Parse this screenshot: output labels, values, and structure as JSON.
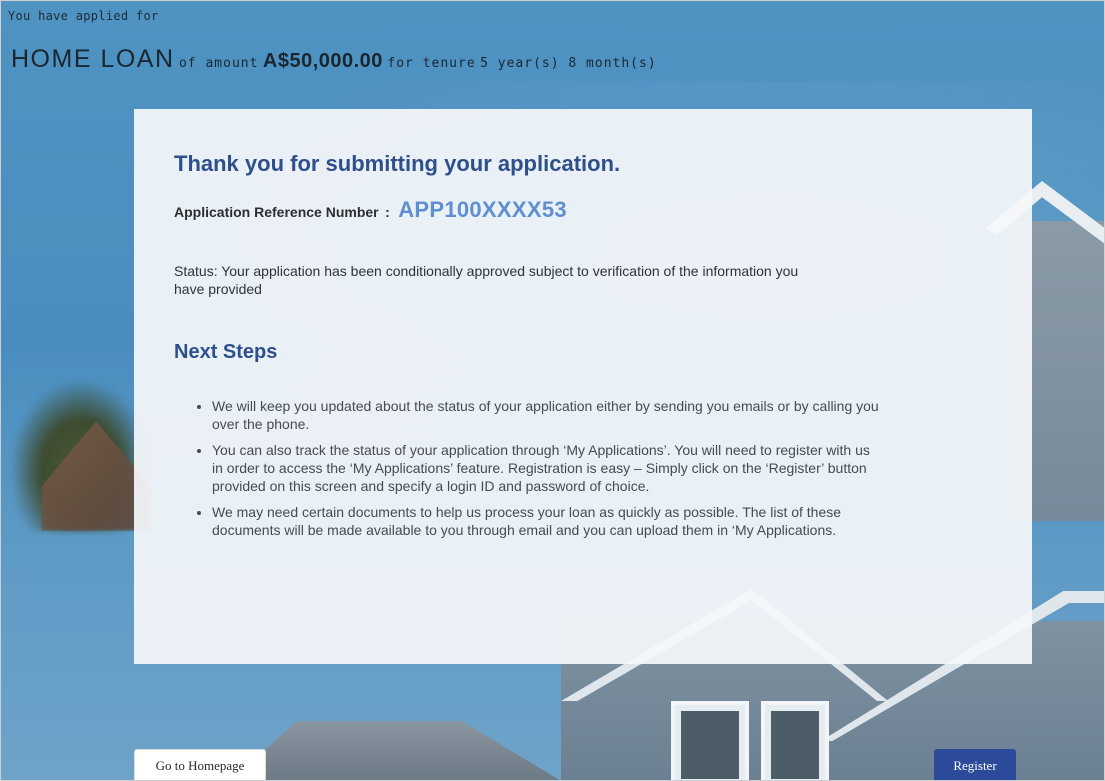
{
  "header": {
    "applied_label": "You have applied for",
    "loan_type": "HOME LOAN",
    "of_amount_label": "of amount",
    "amount": "A$50,000.00",
    "tenure_label": "for tenure",
    "tenure": "5 year(s) 8 month(s)"
  },
  "confirmation": {
    "title": "Thank you for submitting your application.",
    "reference_label": "Application Reference Number",
    "reference_separator": ":",
    "reference_number": "APP100XXXX53",
    "status": "Status: Your application has been conditionally approved subject to verification of the information you have provided",
    "next_steps_title": "Next Steps",
    "next_steps": [
      "We will keep you updated about the status of your application either by sending you emails or by calling you over the phone.",
      "You can also track the status of your application through ‘My Applications’. You will need to register with us in order to access the ‘My Applications’ feature. Registration is easy – Simply click on the ‘Register’ button provided on this screen and specify a login ID and password of choice.",
      "We may need certain documents to help us process your loan as quickly as possible. The list of these documents will be made available to you through email and you can upload them in ‘My Applications."
    ]
  },
  "actions": {
    "home_label": "Go to Homepage",
    "register_label": "Register"
  },
  "colors": {
    "accent": "#2f4f8b",
    "reference": "#5f8fd1",
    "register_button": "#2b4a9a"
  }
}
